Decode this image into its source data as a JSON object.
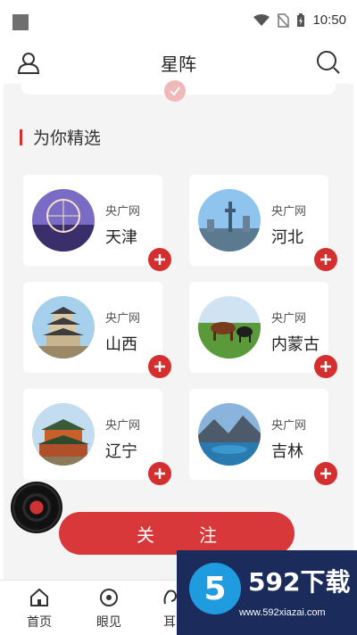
{
  "status": {
    "time": "10:50"
  },
  "header": {
    "title": "星阵",
    "icons": [
      "user-icon",
      "search-icon"
    ]
  },
  "section": {
    "title": "为你精选"
  },
  "cards": [
    {
      "source": "央广网",
      "name": "天津",
      "image": "tianjin-eye-image"
    },
    {
      "source": "央广网",
      "name": "河北",
      "image": "hebei-city-image"
    },
    {
      "source": "央广网",
      "name": "山西",
      "image": "shanxi-tower-image"
    },
    {
      "source": "央广网",
      "name": "内蒙古",
      "image": "inner-mongolia-cattle-image"
    },
    {
      "source": "央广网",
      "name": "辽宁",
      "image": "liaoning-palace-image"
    },
    {
      "source": "央广网",
      "name": "吉林",
      "image": "jilin-lake-image"
    }
  ],
  "follow_button": {
    "label": "关注"
  },
  "nav": {
    "items": [
      {
        "label": "首页",
        "icon": "home-icon"
      },
      {
        "label": "眼见",
        "icon": "eye-icon"
      },
      {
        "label": "耳",
        "icon": "ear-icon"
      }
    ]
  },
  "watermark": {
    "title": "592下载",
    "url": "www.592xiazai.com",
    "logo_text": "5"
  },
  "colors": {
    "accent": "#d32f2f",
    "background": "#f4f4f4"
  }
}
